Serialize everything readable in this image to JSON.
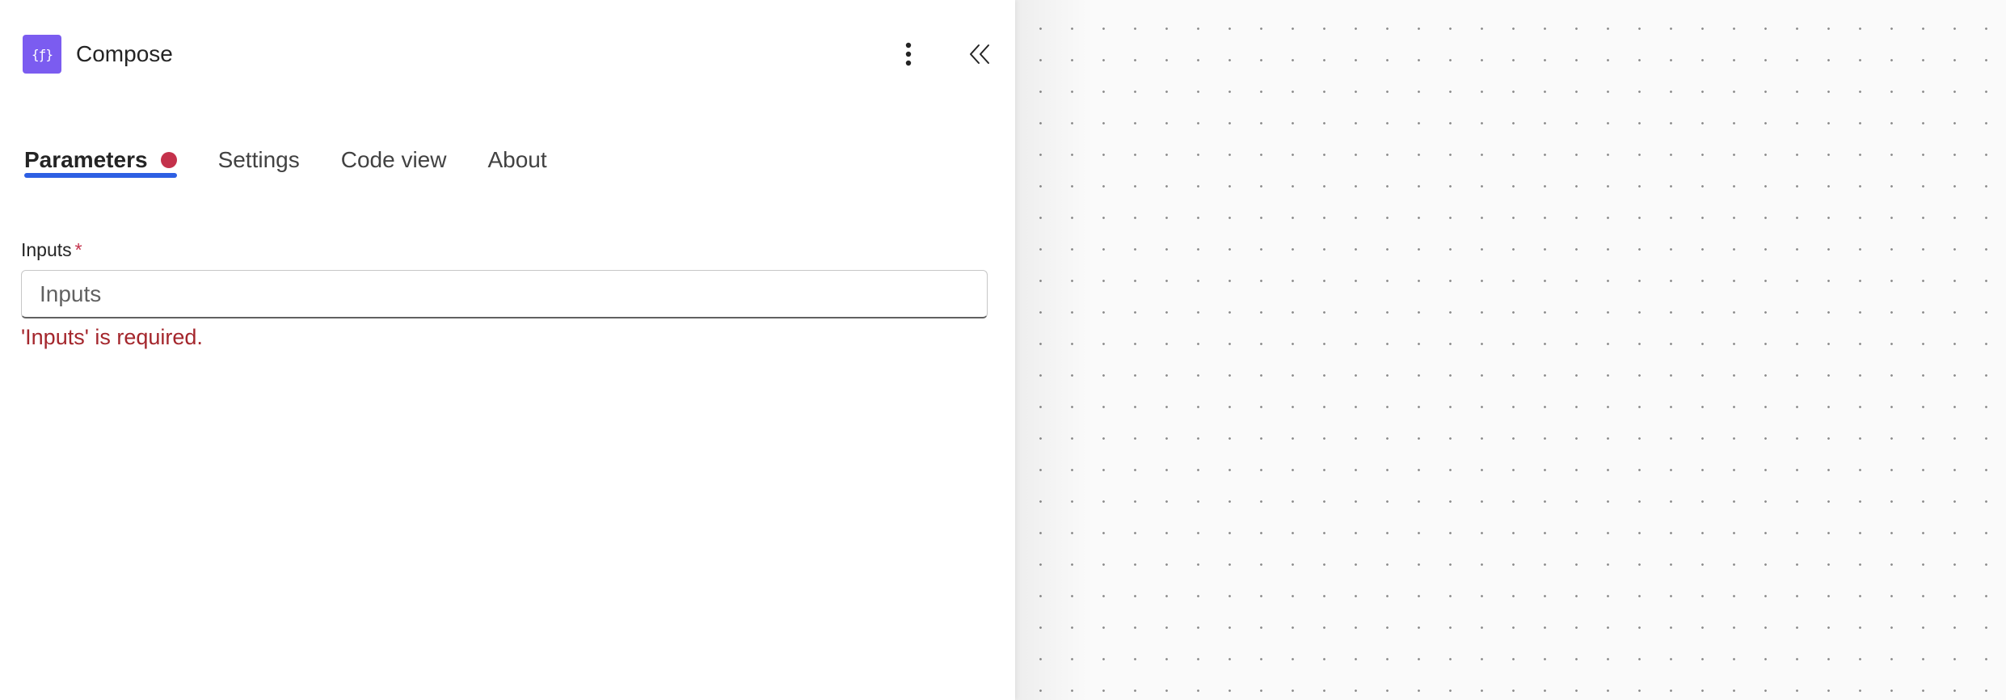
{
  "panel": {
    "icon_label": "{ƒ}",
    "title": "Compose",
    "actions": {
      "more_icon": "more-vertical-icon",
      "collapse_icon": "double-chevron-left-icon"
    }
  },
  "tabs": [
    {
      "label": "Parameters",
      "active": true,
      "has_error": true
    },
    {
      "label": "Settings",
      "active": false
    },
    {
      "label": "Code view",
      "active": false
    },
    {
      "label": "About",
      "active": false
    }
  ],
  "field": {
    "label": "Inputs",
    "required_marker": "*",
    "placeholder": "Inputs",
    "value": "",
    "error": "'Inputs' is required."
  },
  "colors": {
    "accent": "#2d5fe3",
    "icon_bg": "#7b5cf0",
    "error": "#a4262c",
    "error_dot": "#c4314b"
  }
}
